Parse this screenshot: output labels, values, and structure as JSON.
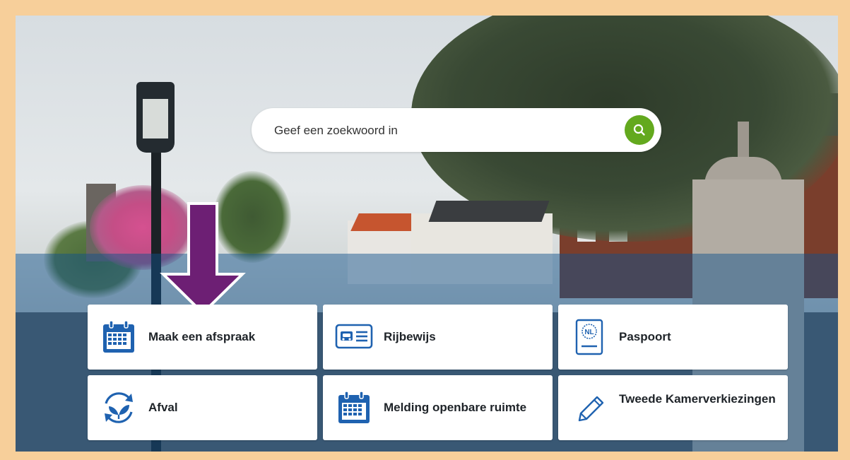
{
  "search": {
    "placeholder": "Geef een zoekwoord in",
    "button_icon": "search-icon"
  },
  "tiles": [
    {
      "label": "Maak een afspraak",
      "icon": "calendar-icon"
    },
    {
      "label": "Rijbewijs",
      "icon": "drivers-license-icon"
    },
    {
      "label": "Paspoort",
      "icon": "passport-icon"
    },
    {
      "label": "Afval",
      "icon": "recycle-icon"
    },
    {
      "label": "Melding openbare ruimte",
      "icon": "calendar-icon"
    },
    {
      "label": "Tweede Kamerverkiezingen",
      "icon": "pencil-icon"
    }
  ],
  "passport_badge": "NL",
  "colors": {
    "frame": "#f7cf9a",
    "accent_green": "#63a91e",
    "icon_blue": "#1f62b0",
    "arrow_purple": "#6d1f74",
    "tile_text": "#1e2328"
  }
}
